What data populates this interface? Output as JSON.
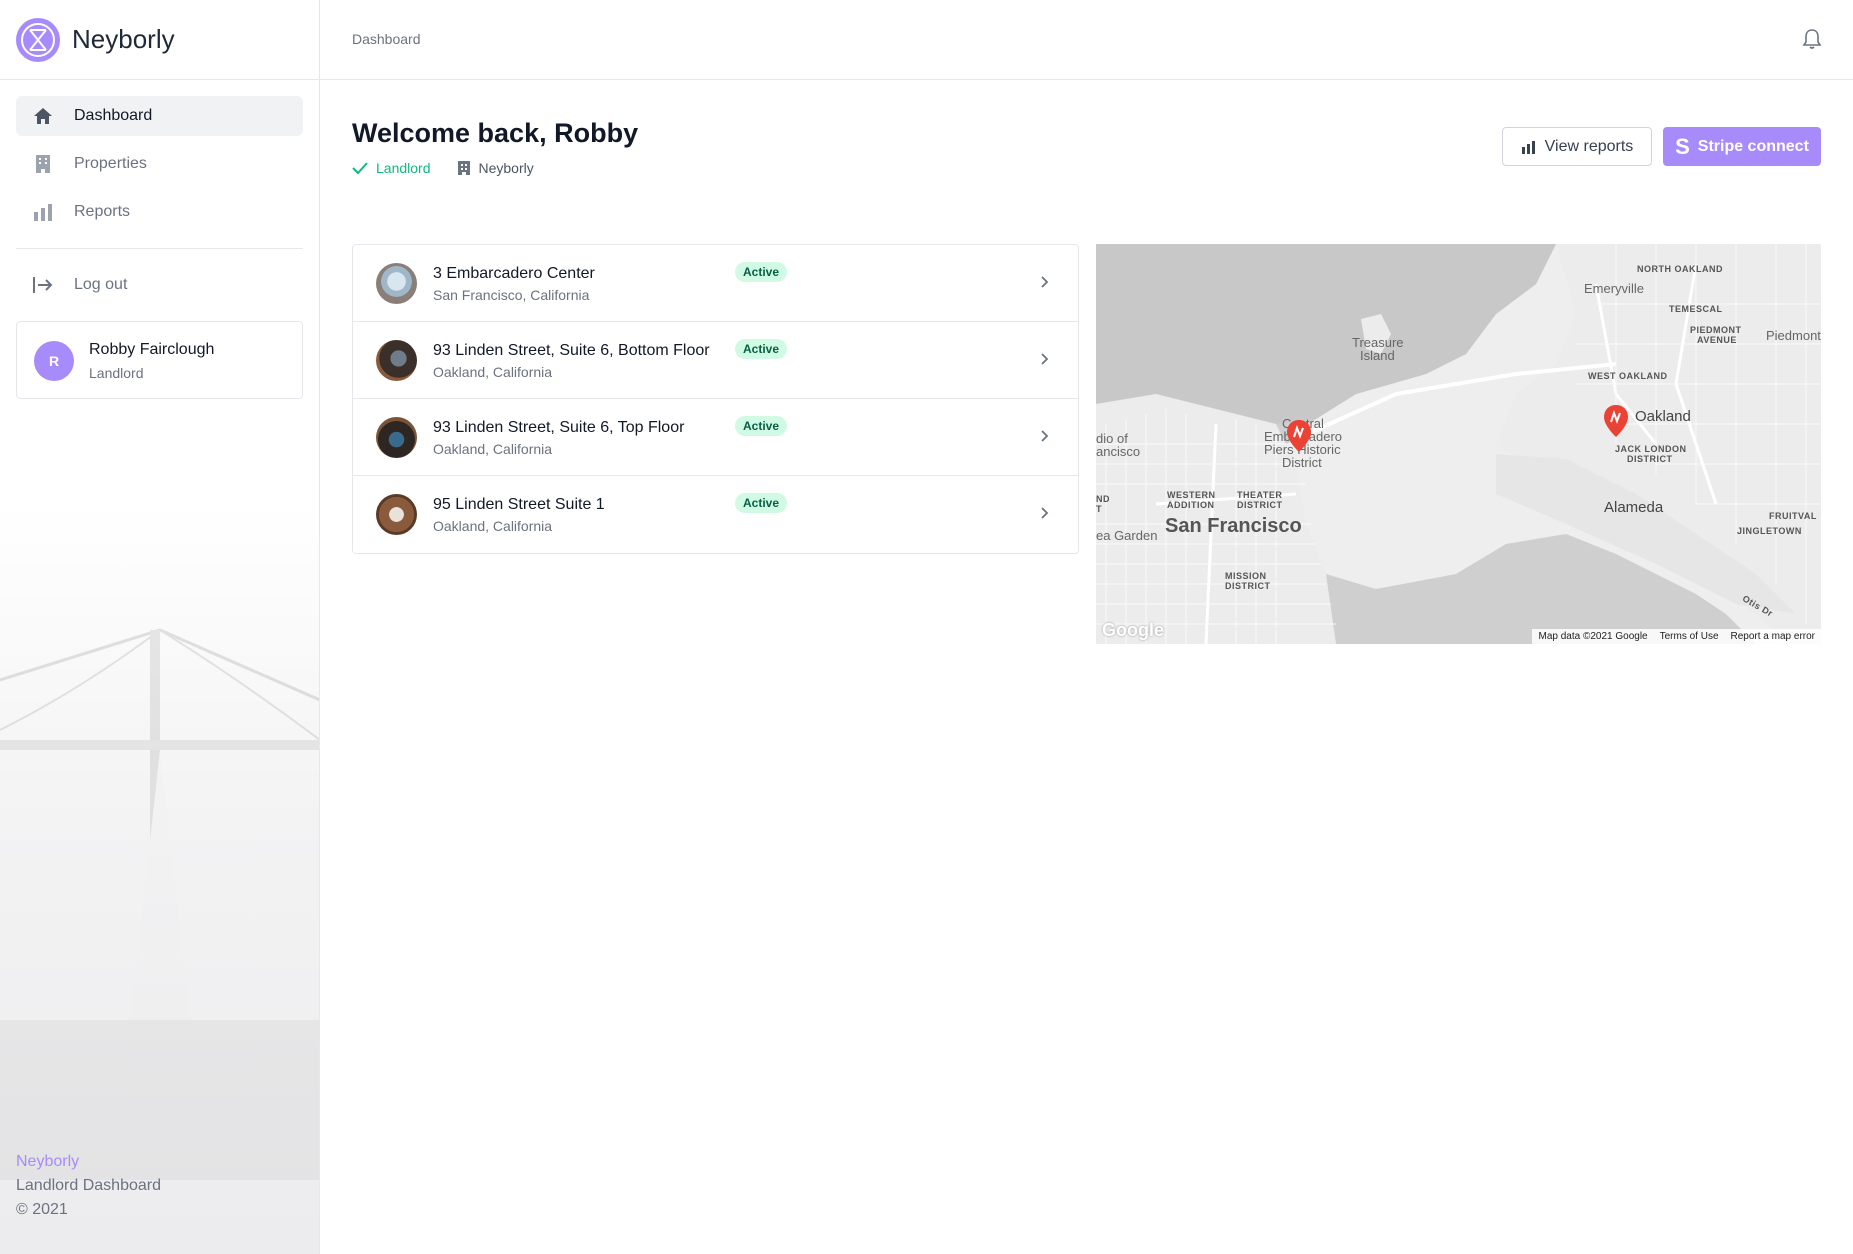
{
  "app": {
    "name": "Neyborly"
  },
  "sidebar": {
    "items": [
      {
        "label": "Dashboard",
        "icon": "home-icon",
        "active": true
      },
      {
        "label": "Properties",
        "icon": "building-icon",
        "active": false
      },
      {
        "label": "Reports",
        "icon": "bar-chart-icon",
        "active": false
      }
    ],
    "logout_label": "Log out",
    "user": {
      "initial": "R",
      "name": "Robby Fairclough",
      "role": "Landlord"
    },
    "footer": {
      "brand": "Neyborly",
      "subtitle": "Landlord Dashboard",
      "copyright": "© 2021"
    }
  },
  "topbar": {
    "breadcrumb": "Dashboard",
    "icon": "bell-icon"
  },
  "header": {
    "welcome": "Welcome back, Robby",
    "role": "Landlord",
    "org": "Neyborly",
    "view_reports_label": "View reports",
    "stripe_label": "Stripe connect",
    "stripe_glyph": "S"
  },
  "properties": [
    {
      "title": "3 Embarcadero Center",
      "location": "San Francisco, California",
      "status": "Active"
    },
    {
      "title": "93 Linden Street, Suite 6, Bottom Floor",
      "location": "Oakland, California",
      "status": "Active"
    },
    {
      "title": "93 Linden Street, Suite 6, Top Floor",
      "location": "Oakland, California",
      "status": "Active"
    },
    {
      "title": "95 Linden Street Suite 1",
      "location": "Oakland, California",
      "status": "Active"
    }
  ],
  "map": {
    "labels": {
      "emeryville": "Emeryville",
      "north_oakland": "NORTH OAKLAND",
      "temescal": "TEMESCAL",
      "piedmont_avenue_1": "PIEDMONT",
      "piedmont_avenue_2": "AVENUE",
      "piedmont": "Piedmont",
      "treasure_island_1": "Treasure",
      "treasure_island_2": "Island",
      "west_oakland": "WEST OAKLAND",
      "oakland": "Oakland",
      "jack_london_1": "JACK LONDON",
      "jack_london_2": "DISTRICT",
      "central_1": "Central",
      "central_2": "Embarcadero",
      "central_3": "Piers Historic",
      "central_4": "District",
      "studio_1": "dio of",
      "studio_2": "ancisco",
      "western_1": "WESTERN",
      "western_2": "ADDITION",
      "theater_1": "THEATER",
      "theater_2": "DISTRICT",
      "nd": "ND",
      "t": "T",
      "san_francisco": "San Francisco",
      "tea_garden": "ea Garden",
      "alameda": "Alameda",
      "fruitvale": "FRUITVAL",
      "jingletown": "JINGLETOWN",
      "mission_1": "MISSION",
      "mission_2": "DISTRICT",
      "otis": "Otis Dr"
    },
    "google": "Google",
    "attribution": [
      "Map data ©2021 Google",
      "Terms of Use",
      "Report a map error"
    ]
  },
  "colors": {
    "accent": "#a78bfa",
    "success": "#10b981",
    "badge_bg": "#d1fae5",
    "pin": "#ea4335"
  }
}
